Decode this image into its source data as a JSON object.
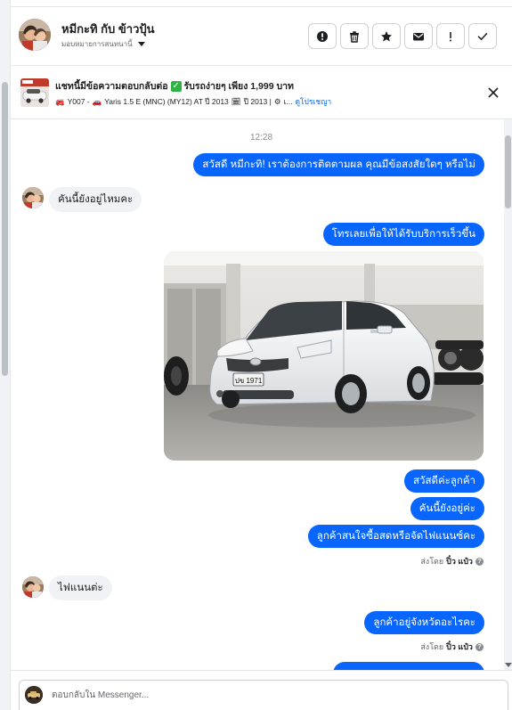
{
  "header": {
    "contact_name": "หมีกะทิ กับ ข้าวปุ้น",
    "assign_label": "มอบหมายการสนทนานี้",
    "actions": [
      {
        "icon": "report-icon"
      },
      {
        "icon": "trash-icon"
      },
      {
        "icon": "star-icon"
      },
      {
        "icon": "envelope-icon"
      },
      {
        "icon": "exclamation-icon"
      },
      {
        "icon": "check-icon"
      }
    ]
  },
  "listing": {
    "title": "แชทนี้มีข้อความตอบกลับต่อ",
    "title_after_check": "รับรถง่ายๆ เพียง 1,999 บาท",
    "stock": "Y007 -",
    "model": "Yaris 1.5 E (MNC) (MY12) AT ปี 2013",
    "year": "ปี 2013 |",
    "more": "เ...",
    "link": "ดูโปรเชญา"
  },
  "chat": {
    "timestamp": "12:28",
    "messages": {
      "out1": "สวัสดี หมีกะทิ! เราต้องการติดตามผล คุณมีข้อสงสัยใดๆ หรือไม่",
      "in1": "คันนี้ยังอยู่ไหมคะ",
      "out2": "โทรเลยเพื่อให้ได้รับบริการเร็วขึ้น",
      "out3": "สวัสดีค่ะลูกค้า",
      "out4": "คันนี้ยังอยู่ค่ะ",
      "out5": "ลูกค้าสนใจซื้อสดหรือจัดไฟแนนซ์คะ",
      "in2": "ไฟแนนต่ะ",
      "out6": "ลูกค้าอยู่จังหวัดอะไรคะ"
    },
    "sent_by_prefix": "ส่งโดย",
    "sent_by_name": "ปิ๋ว แป๋ว",
    "plate": "ปข 1971"
  },
  "composer": {
    "placeholder": "ตอบกลับใน Messenger..."
  },
  "colors": {
    "outgoing_bubble": "#0866ff",
    "incoming_bubble": "#f0f2f5",
    "link": "#0a66d6",
    "check": "#2fb344"
  }
}
